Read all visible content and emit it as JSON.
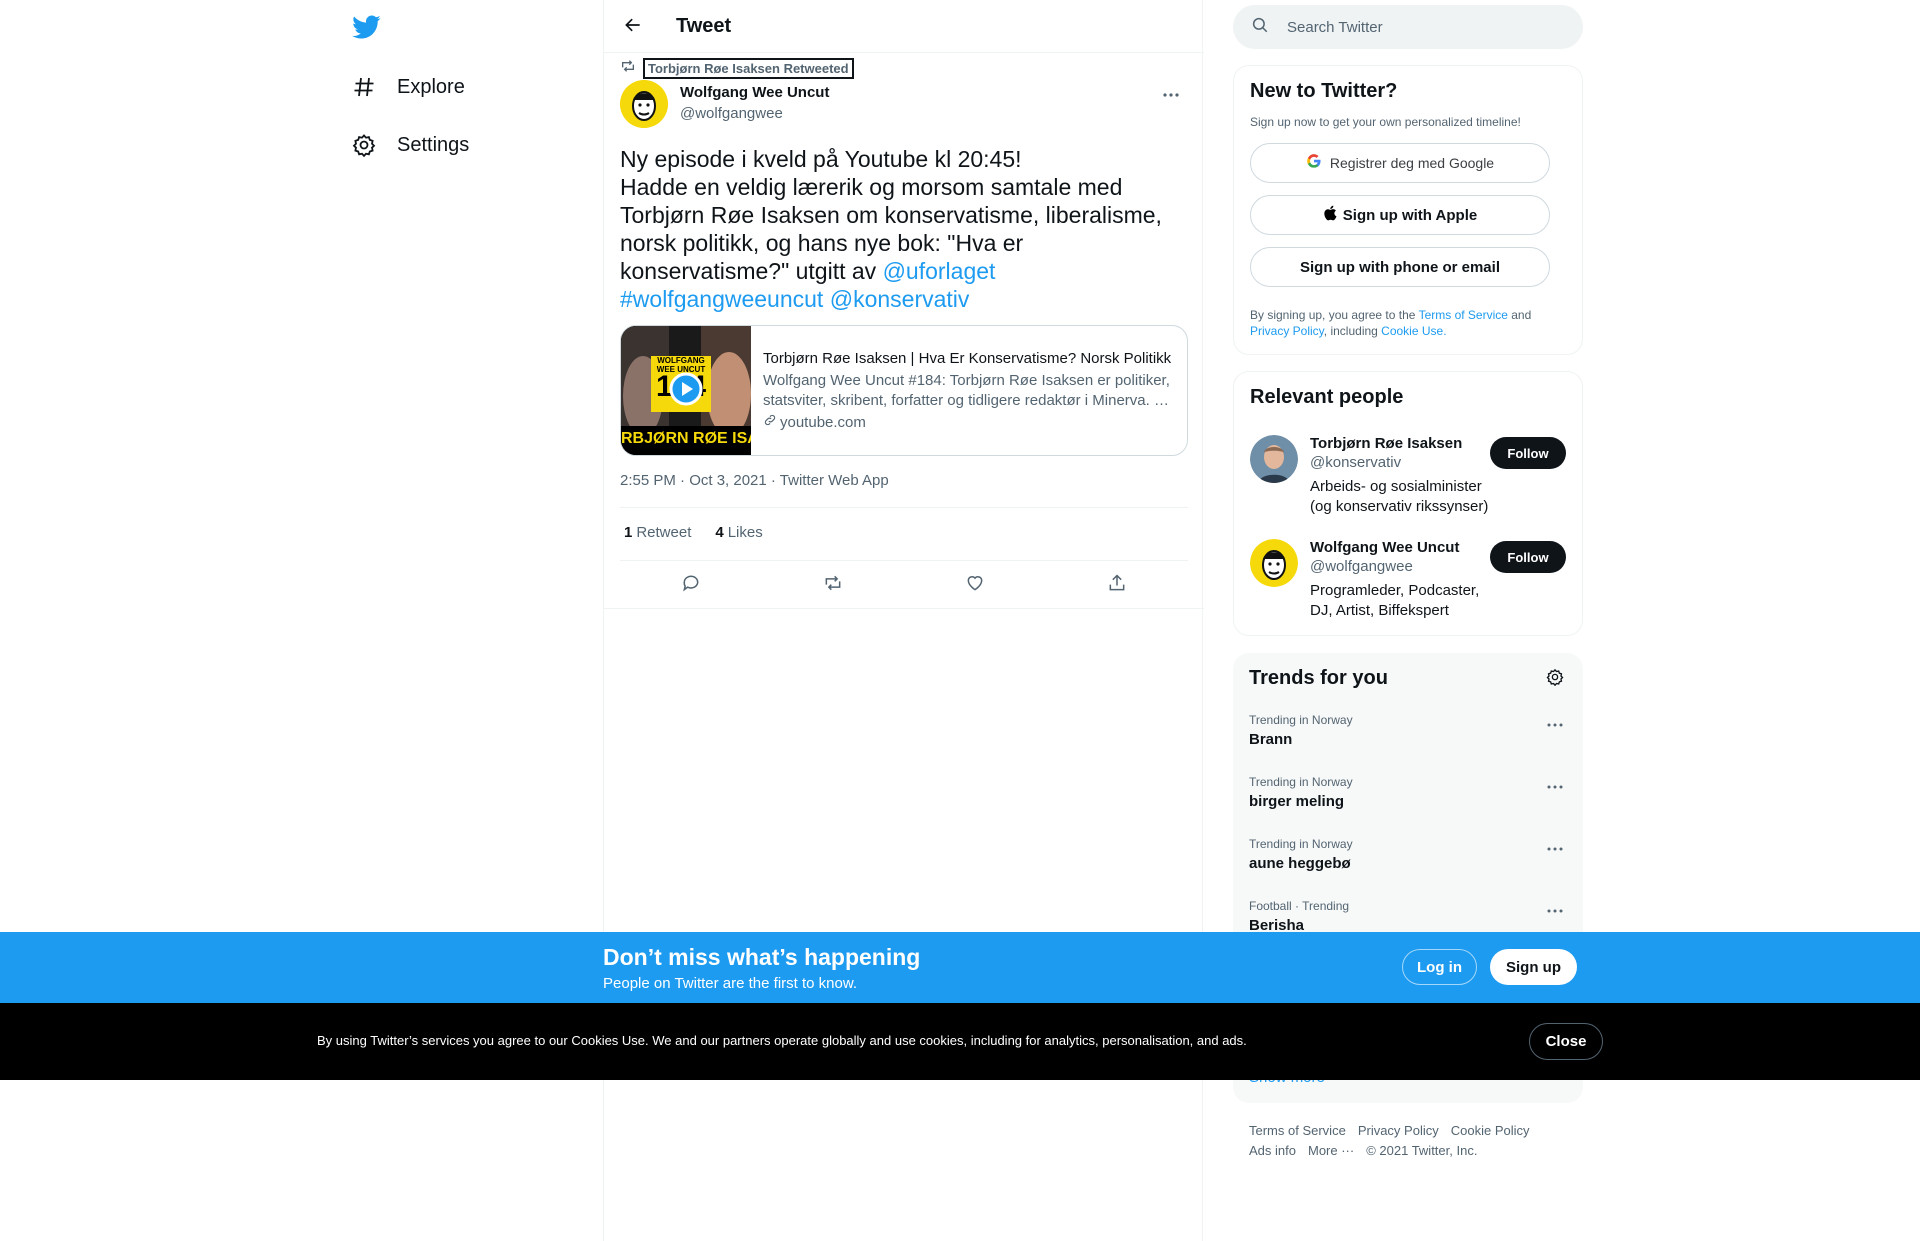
{
  "nav": {
    "logo": "twitter-bird-icon",
    "items": [
      {
        "label": "Explore",
        "icon": "hashtag-icon"
      },
      {
        "label": "Settings",
        "icon": "gear-icon"
      }
    ]
  },
  "header": {
    "title": "Tweet",
    "back_icon": "arrow-left-icon"
  },
  "tweet": {
    "retweeted_by": "Torbjørn Røe Isaksen Retweeted",
    "author_name": "Wolfgang Wee Uncut",
    "author_handle": "@wolfgangwee",
    "text_line1": "Ny episode i kveld på Youtube kl 20:45!",
    "text_line2": "Hadde en veldig lærerik og morsom samtale med Torbjørn Røe Isaksen om konservatisme, liberalisme, norsk politikk, og hans nye bok: \"Hva er konservatisme?\" utgitt av ",
    "mention1": "@uforlaget",
    "hashtag": "#wolfgangweeuncut",
    "mention2": "@konservativ",
    "card": {
      "thumb_top": "WOLFGANG WEE UNCUT",
      "thumb_num": "184",
      "thumb_bottom": "RBJØRN RØE ISAK",
      "title": "Torbjørn Røe Isaksen | Hva Er Konservatisme? Norsk Politikk",
      "description": "Wolfgang Wee Uncut #184: Torbjørn Røe Isaksen er politiker, statsviter, skribent, forfatter og tidligere redaktør i Minerva. …",
      "domain": "youtube.com"
    },
    "timestamp": "2:55 PM · Oct 3, 2021 · Twitter Web App",
    "retweets_count": "1",
    "retweets_label": "Retweet",
    "likes_count": "4",
    "likes_label": "Likes"
  },
  "search": {
    "placeholder": "Search Twitter"
  },
  "signup": {
    "title": "New to Twitter?",
    "subtitle": "Sign up now to get your own personalized timeline!",
    "google_label": "Registrer deg med Google",
    "apple_label": "Sign up with Apple",
    "phone_label": "Sign up with phone or email",
    "terms_prefix": "By signing up, you agree to the ",
    "terms_link": "Terms of Service",
    "terms_and": " and ",
    "privacy_link": "Privacy Policy",
    "terms_including": ", including ",
    "cookie_link": "Cookie Use."
  },
  "relevant": {
    "title": "Relevant people",
    "people": [
      {
        "name": "Torbjørn Røe Isaksen",
        "handle": "@konservativ",
        "bio": "Arbeids- og sosialminister (og konservativ rikssynser)",
        "follow": "Follow"
      },
      {
        "name": "Wolfgang Wee Uncut",
        "handle": "@wolfgangwee",
        "bio": "Programleder, Podcaster, DJ, Artist, Biffekspert",
        "follow": "Follow"
      }
    ]
  },
  "trends": {
    "title": "Trends for you",
    "items": [
      {
        "context": "Trending in Norway",
        "name": "Brann"
      },
      {
        "context": "Trending in Norway",
        "name": "birger meling"
      },
      {
        "context": "Trending in Norway",
        "name": "aune heggebø"
      },
      {
        "context": "Football · Trending",
        "name": "Berisha"
      }
    ],
    "show_more": "Show more"
  },
  "footer": {
    "terms": "Terms of Service",
    "privacy": "Privacy Policy",
    "cookie": "Cookie Policy",
    "ads": "Ads info",
    "more": "More ···",
    "copyright": "© 2021 Twitter, Inc."
  },
  "banner": {
    "title": "Don’t miss what’s happening",
    "subtitle": "People on Twitter are the first to know.",
    "login": "Log in",
    "signup": "Sign up"
  },
  "cookie_bar": {
    "text": "By using Twitter’s services you agree to our Cookies Use. We and our partners operate globally and use cookies, including for analytics, personalisation, and ads.",
    "close": "Close"
  },
  "colors": {
    "accent": "#1d9bf0",
    "text": "#0f1419",
    "muted": "#536471",
    "border": "#eff3f4"
  }
}
